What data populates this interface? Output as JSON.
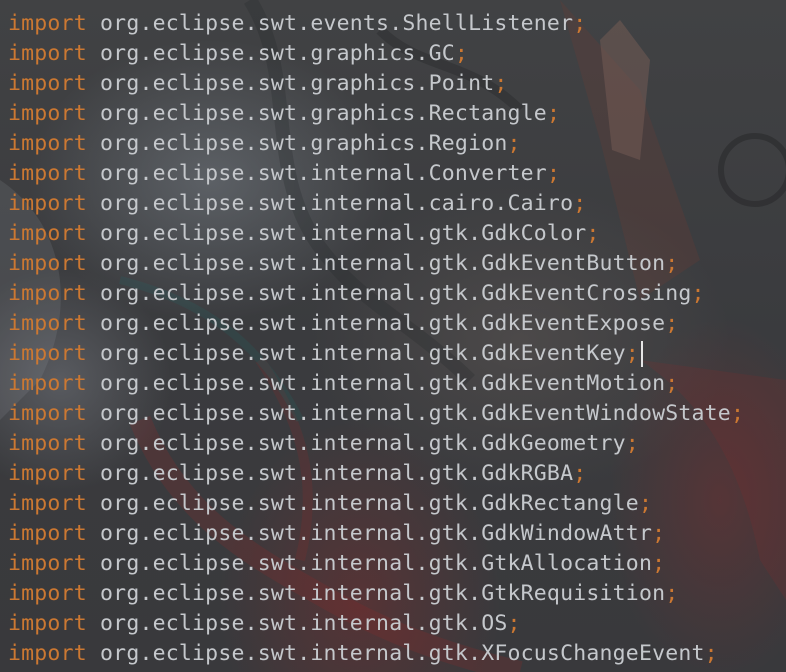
{
  "editor": {
    "keyword": "import",
    "terminator": ";",
    "caret_line": 11,
    "colors": {
      "keyword": "#cc7832",
      "identifier": "#c5c8cc",
      "background": "#3b3d40"
    },
    "lines": [
      "org.eclipse.swt.events.ShellListener",
      "org.eclipse.swt.graphics.GC",
      "org.eclipse.swt.graphics.Point",
      "org.eclipse.swt.graphics.Rectangle",
      "org.eclipse.swt.graphics.Region",
      "org.eclipse.swt.internal.Converter",
      "org.eclipse.swt.internal.cairo.Cairo",
      "org.eclipse.swt.internal.gtk.GdkColor",
      "org.eclipse.swt.internal.gtk.GdkEventButton",
      "org.eclipse.swt.internal.gtk.GdkEventCrossing",
      "org.eclipse.swt.internal.gtk.GdkEventExpose",
      "org.eclipse.swt.internal.gtk.GdkEventKey",
      "org.eclipse.swt.internal.gtk.GdkEventMotion",
      "org.eclipse.swt.internal.gtk.GdkEventWindowState",
      "org.eclipse.swt.internal.gtk.GdkGeometry",
      "org.eclipse.swt.internal.gtk.GdkRGBA",
      "org.eclipse.swt.internal.gtk.GdkRectangle",
      "org.eclipse.swt.internal.gtk.GdkWindowAttr",
      "org.eclipse.swt.internal.gtk.GtkAllocation",
      "org.eclipse.swt.internal.gtk.GtkRequisition",
      "org.eclipse.swt.internal.gtk.OS",
      "org.eclipse.swt.internal.gtk.XFocusChangeEvent"
    ]
  }
}
